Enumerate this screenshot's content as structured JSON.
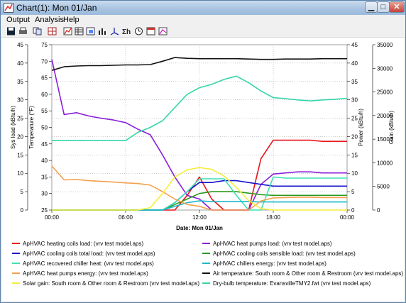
{
  "window": {
    "title": "Chart(1): Mon 01/Jan"
  },
  "menu": {
    "output": "Output",
    "analysis": "Analysis",
    "help": "Help"
  },
  "toolbar": [
    "save-icon",
    "print-icon",
    "copy-icon",
    "grid-icon",
    "chart-icon",
    "table-icon",
    "export-icon",
    "histogram-icon",
    "axes-icon",
    "sum-icon",
    "clock-icon",
    "calendar-icon",
    "chart-options-icon"
  ],
  "chart_data": {
    "type": "line",
    "xlabel": "Date: Mon 01/Jan",
    "x_ticks": [
      "00:00",
      "06:00",
      "12:00",
      "18:00",
      "00:00"
    ],
    "axes": {
      "sys_load": {
        "label": "Sys load (kBtu/h)",
        "range": [
          0,
          45
        ],
        "ticks": [
          0,
          5,
          10,
          15,
          20,
          25,
          30,
          35,
          40,
          45
        ]
      },
      "temperature": {
        "label": "Temperature (°F)",
        "range": [
          25,
          75
        ],
        "ticks": [
          25,
          30,
          35,
          40,
          45,
          50,
          55,
          60,
          65,
          70,
          75
        ]
      },
      "power": {
        "label": "Power (kBtu/h)",
        "range": [
          0,
          45
        ],
        "ticks": [
          0,
          5,
          10,
          15,
          20,
          25,
          30,
          35,
          40,
          45
        ]
      },
      "gain": {
        "label": "Gain (kBtu/h)",
        "range": [
          0,
          35000
        ],
        "ticks": [
          0,
          5000,
          10000,
          15000,
          20000,
          25000,
          30000,
          35000
        ]
      }
    },
    "series": [
      {
        "name": "ApHVAC heating coils load:  (vrv test model.aps)",
        "color": "#e8151b",
        "axis": "sys_load",
        "points": [
          [
            0,
            0
          ],
          [
            1,
            0
          ],
          [
            2,
            0
          ],
          [
            3,
            0
          ],
          [
            4,
            0
          ],
          [
            5,
            0
          ],
          [
            6,
            0
          ],
          [
            7,
            0
          ],
          [
            8,
            0
          ],
          [
            9,
            0
          ],
          [
            10,
            0
          ],
          [
            11,
            4
          ],
          [
            12,
            9
          ],
          [
            13,
            3
          ],
          [
            14,
            0
          ],
          [
            15,
            0
          ],
          [
            16,
            0
          ],
          [
            17,
            14
          ],
          [
            18,
            19
          ],
          [
            19,
            19
          ],
          [
            20,
            19
          ],
          [
            21,
            19
          ],
          [
            22,
            18.7
          ],
          [
            23,
            18.7
          ],
          [
            24,
            18.7
          ]
        ]
      },
      {
        "name": "ApHVAC heat pumps load:  (vrv test model.aps)",
        "color": "#8b1fdc",
        "axis": "sys_load",
        "points": [
          [
            0,
            41
          ],
          [
            1,
            26
          ],
          [
            2,
            26.5
          ],
          [
            3,
            25.6
          ],
          [
            4,
            25
          ],
          [
            5,
            24.5
          ],
          [
            6,
            23.8
          ],
          [
            7,
            22
          ],
          [
            8,
            20.5
          ],
          [
            9,
            15
          ],
          [
            10,
            9
          ],
          [
            11,
            4
          ],
          [
            12,
            3
          ],
          [
            13,
            0
          ],
          [
            14,
            0
          ],
          [
            15,
            0
          ],
          [
            16,
            0
          ],
          [
            17,
            7
          ],
          [
            18,
            9.8
          ],
          [
            19,
            10.1
          ],
          [
            20,
            10.4
          ],
          [
            21,
            10.4
          ],
          [
            22,
            10.1
          ],
          [
            23,
            10.1
          ],
          [
            24,
            10.1
          ]
        ]
      },
      {
        "name": "ApHVAC cooling coils total load:  (vrv test model.aps)",
        "color": "#1313cc",
        "axis": "sys_load",
        "points": [
          [
            0,
            0
          ],
          [
            1,
            0
          ],
          [
            2,
            0
          ],
          [
            3,
            0
          ],
          [
            4,
            0
          ],
          [
            5,
            0
          ],
          [
            6,
            0
          ],
          [
            7,
            0
          ],
          [
            8,
            0
          ],
          [
            9,
            0
          ],
          [
            10,
            2
          ],
          [
            11,
            5
          ],
          [
            12,
            7.5
          ],
          [
            13,
            7.5
          ],
          [
            14,
            8
          ],
          [
            15,
            8
          ],
          [
            16,
            7.5
          ],
          [
            17,
            7
          ],
          [
            18,
            6.5
          ],
          [
            19,
            6.5
          ],
          [
            20,
            6.5
          ],
          [
            21,
            6.5
          ],
          [
            22,
            6.5
          ],
          [
            23,
            6.5
          ],
          [
            24,
            6.5
          ]
        ]
      },
      {
        "name": "ApHVAC cooling coils sensible load:  (vrv test model.aps)",
        "color": "#2a9a1f",
        "axis": "sys_load",
        "points": [
          [
            0,
            0
          ],
          [
            1,
            0
          ],
          [
            2,
            0
          ],
          [
            3,
            0
          ],
          [
            4,
            0
          ],
          [
            5,
            0
          ],
          [
            6,
            0
          ],
          [
            7,
            0
          ],
          [
            8,
            0
          ],
          [
            9,
            0
          ],
          [
            10,
            1.5
          ],
          [
            11,
            3
          ],
          [
            12,
            4.5
          ],
          [
            13,
            5
          ],
          [
            14,
            5
          ],
          [
            15,
            5
          ],
          [
            16,
            4.6
          ],
          [
            17,
            4.2
          ],
          [
            18,
            4
          ],
          [
            19,
            4
          ],
          [
            20,
            4
          ],
          [
            21,
            4
          ],
          [
            22,
            4
          ],
          [
            23,
            4
          ],
          [
            24,
            4
          ]
        ]
      },
      {
        "name": "ApHVAC recovered chiller heat:  (vrv test model.aps)",
        "color": "#3fe0b4",
        "axis": "sys_load",
        "points": [
          [
            0,
            0
          ],
          [
            1,
            0
          ],
          [
            2,
            0
          ],
          [
            3,
            0
          ],
          [
            4,
            0
          ],
          [
            5,
            0
          ],
          [
            6,
            0
          ],
          [
            7,
            0
          ],
          [
            8,
            0
          ],
          [
            9,
            0
          ],
          [
            10,
            2
          ],
          [
            11,
            5
          ],
          [
            12,
            8.5
          ],
          [
            13,
            8.5
          ],
          [
            14,
            8.5
          ],
          [
            15,
            4
          ],
          [
            16,
            0
          ],
          [
            17,
            0
          ],
          [
            18,
            9
          ],
          [
            19,
            8.7
          ],
          [
            20,
            8.7
          ],
          [
            21,
            8.7
          ],
          [
            22,
            8.7
          ],
          [
            23,
            8.7
          ],
          [
            24,
            8.7
          ]
        ]
      },
      {
        "name": "ApHVAC chillers energy:  (vrv test model.aps)",
        "color": "#1bb8c8",
        "axis": "sys_load",
        "points": [
          [
            0,
            0
          ],
          [
            1,
            0
          ],
          [
            2,
            0
          ],
          [
            3,
            0
          ],
          [
            4,
            0
          ],
          [
            5,
            0
          ],
          [
            6,
            0
          ],
          [
            7,
            0
          ],
          [
            8,
            0
          ],
          [
            9,
            0
          ],
          [
            10,
            1
          ],
          [
            11,
            2
          ],
          [
            12,
            2.5
          ],
          [
            13,
            2.3
          ],
          [
            14,
            2.3
          ],
          [
            15,
            2.3
          ],
          [
            16,
            2.3
          ],
          [
            17,
            2.2
          ],
          [
            18,
            2.2
          ],
          [
            19,
            2.2
          ],
          [
            20,
            2.2
          ],
          [
            21,
            2.2
          ],
          [
            22,
            2.2
          ],
          [
            23,
            2.2
          ],
          [
            24,
            2.2
          ]
        ]
      },
      {
        "name": "ApHVAC heat pumps energy:  (vrv test model.aps)",
        "color": "#f5a04d",
        "axis": "sys_load",
        "points": [
          [
            0,
            12
          ],
          [
            1,
            8.2
          ],
          [
            2,
            8.3
          ],
          [
            3,
            8
          ],
          [
            4,
            7.8
          ],
          [
            5,
            7.6
          ],
          [
            6,
            7.4
          ],
          [
            7,
            7.2
          ],
          [
            8,
            6.8
          ],
          [
            9,
            5
          ],
          [
            10,
            3
          ],
          [
            11,
            1.5
          ],
          [
            12,
            1
          ],
          [
            13,
            0
          ],
          [
            14,
            0
          ],
          [
            15,
            0
          ],
          [
            16,
            0
          ],
          [
            17,
            2.5
          ],
          [
            18,
            3.3
          ],
          [
            19,
            3.4
          ],
          [
            20,
            3.5
          ],
          [
            21,
            3.5
          ],
          [
            22,
            3.4
          ],
          [
            23,
            3.4
          ],
          [
            24,
            3.4
          ]
        ]
      },
      {
        "name": "Air temperature:  South room & Other room & Restroom  (vrv test model.aps)",
        "color": "#111111",
        "axis": "sys_load",
        "points": [
          [
            0,
            38
          ],
          [
            1,
            39
          ],
          [
            2,
            39.2
          ],
          [
            3,
            39.3
          ],
          [
            4,
            39.3
          ],
          [
            5,
            39.4
          ],
          [
            6,
            39.5
          ],
          [
            7,
            39.5
          ],
          [
            8,
            39.6
          ],
          [
            9,
            40.5
          ],
          [
            10,
            41.5
          ],
          [
            11,
            41.3
          ],
          [
            12,
            41.2
          ],
          [
            13,
            41.2
          ],
          [
            14,
            41.2
          ],
          [
            15,
            41.2
          ],
          [
            16,
            41.1
          ],
          [
            17,
            41
          ],
          [
            18,
            41
          ],
          [
            19,
            41.1
          ],
          [
            20,
            41.1
          ],
          [
            21,
            41.1
          ],
          [
            22,
            41.2
          ],
          [
            23,
            41.2
          ],
          [
            24,
            41.2
          ]
        ]
      },
      {
        "name": "Solar gain:  South room & Other room & Restroom  (vrv test model.aps)",
        "color": "#f5ee3a",
        "axis": "gain",
        "points": [
          [
            0,
            0
          ],
          [
            1,
            0
          ],
          [
            2,
            0
          ],
          [
            3,
            0
          ],
          [
            4,
            0
          ],
          [
            5,
            0
          ],
          [
            6,
            0
          ],
          [
            7,
            0
          ],
          [
            8,
            500
          ],
          [
            9,
            3500
          ],
          [
            10,
            7000
          ],
          [
            11,
            8500
          ],
          [
            12,
            9000
          ],
          [
            13,
            8600
          ],
          [
            14,
            7200
          ],
          [
            15,
            4800
          ],
          [
            16,
            2000
          ],
          [
            17,
            300
          ],
          [
            18,
            0
          ],
          [
            19,
            0
          ],
          [
            20,
            0
          ],
          [
            21,
            0
          ],
          [
            22,
            0
          ],
          [
            23,
            0
          ],
          [
            24,
            0
          ]
        ]
      },
      {
        "name": "Dry-bulb temperature:  EvansvilleTMY2.fwt  (vrv test model.aps)",
        "color": "#33d6a8",
        "axis": "temperature",
        "points": [
          [
            0,
            46
          ],
          [
            1,
            46
          ],
          [
            2,
            46
          ],
          [
            3,
            46
          ],
          [
            4,
            46
          ],
          [
            5,
            46
          ],
          [
            6,
            46
          ],
          [
            7,
            48.5
          ],
          [
            8,
            50
          ],
          [
            9,
            52
          ],
          [
            10,
            56
          ],
          [
            11,
            60
          ],
          [
            12,
            62
          ],
          [
            13,
            63
          ],
          [
            14,
            64.5
          ],
          [
            15,
            65.5
          ],
          [
            16,
            63.5
          ],
          [
            17,
            61
          ],
          [
            18,
            59
          ],
          [
            19,
            58.7
          ],
          [
            20,
            58.3
          ],
          [
            21,
            58
          ],
          [
            22,
            58.3
          ],
          [
            23,
            58.5
          ],
          [
            24,
            58.8
          ]
        ]
      }
    ]
  }
}
